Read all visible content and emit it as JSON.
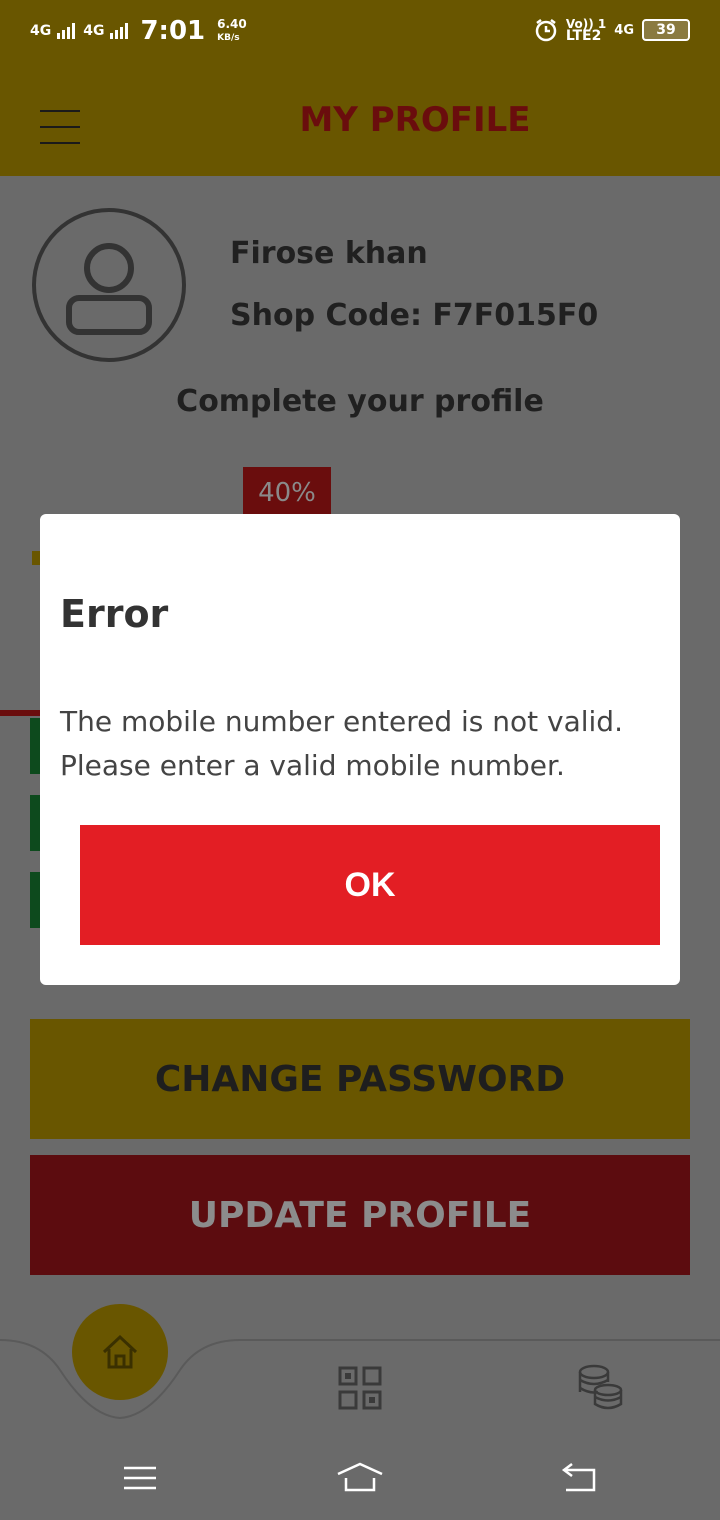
{
  "status_bar": {
    "signal_1": "4G",
    "signal_2": "4G",
    "time": "7:01",
    "net_speed_value": "6.40",
    "net_speed_unit": "KB/s",
    "volte": "Vo)) 1",
    "lte": "LTE2",
    "net_type": "4G",
    "battery": "39"
  },
  "header": {
    "title": "MY PROFILE"
  },
  "profile": {
    "name": "Firose khan",
    "shop_code": "Shop Code: F7F015F0",
    "complete_title": "Complete your profile",
    "progress_percent_label": "40%",
    "progress_fraction": 0.4
  },
  "buttons": {
    "change_password": "CHANGE PASSWORD",
    "update_profile": "UPDATE PROFILE"
  },
  "dialog": {
    "title": "Error",
    "message_line1": "The mobile number entered is not valid.",
    "message_line2": "Please enter a valid mobile number.",
    "ok_label": "OK"
  },
  "bottom_nav": {
    "icons": [
      "home-icon",
      "qr-code-icon",
      "coins-icon"
    ]
  },
  "system_nav": {
    "icons": [
      "menu-icon",
      "home-icon",
      "back-icon"
    ]
  },
  "colors": {
    "accent_gold": "#695600",
    "accent_red": "#e31e24"
  }
}
